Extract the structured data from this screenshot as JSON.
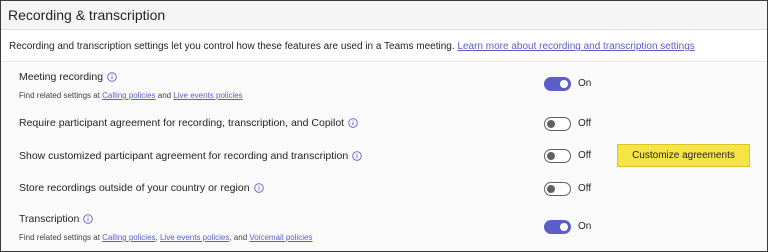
{
  "header": {
    "title": "Recording & transcription"
  },
  "description": {
    "text": "Recording and transcription settings let you control how these features are used in a Teams meeting. ",
    "link": "Learn more about recording and transcription settings"
  },
  "settings": {
    "meeting_recording": {
      "label": "Meeting recording",
      "sub_prefix": "Find related settings at ",
      "link1": "Calling policies",
      "sep1": " and ",
      "link2": "Live events policies",
      "state": "On"
    },
    "participant_agreement": {
      "label": "Require participant agreement for recording, transcription, and Copilot",
      "state": "Off"
    },
    "custom_agreement": {
      "label": "Show customized participant agreement for recording and transcription",
      "state": "Off",
      "button": "Customize agreements"
    },
    "store_outside": {
      "label": "Store recordings outside of your country or region",
      "state": "Off"
    },
    "transcription": {
      "label": "Transcription",
      "sub_prefix": "Find related settings at ",
      "link1": "Calling policies",
      "sep1": ", ",
      "link2": "Live events policies",
      "sep2": ", and ",
      "link3": "Voicemail policies",
      "state": "On"
    }
  },
  "colors": {
    "accent": "#5b5fc7",
    "button": "#f6e445"
  },
  "icons": {
    "info": "info-icon"
  }
}
